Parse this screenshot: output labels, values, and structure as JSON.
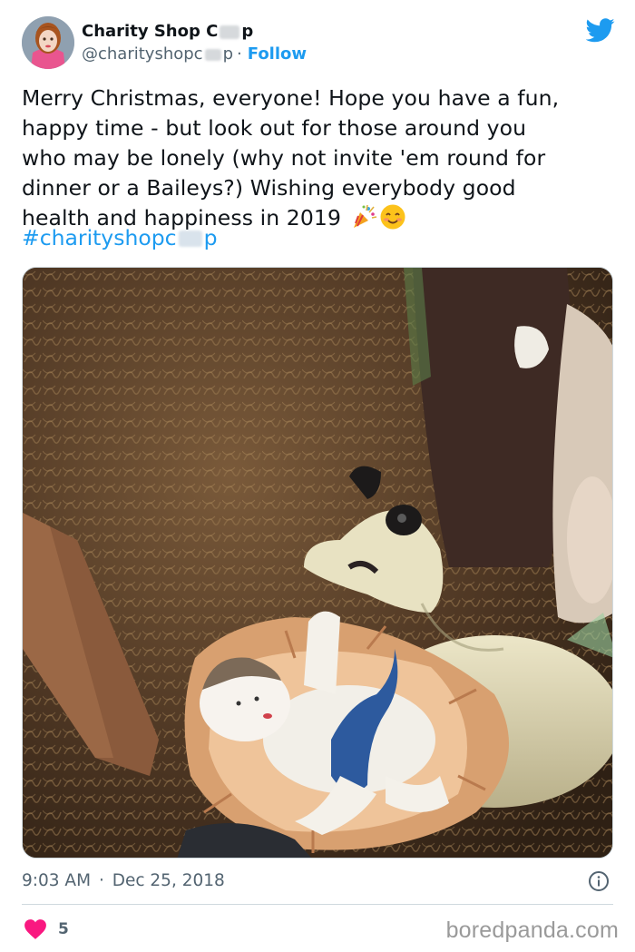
{
  "author": {
    "display_name_start": "Charity Shop C",
    "display_name_end": "p",
    "handle_start": "@charityshopc",
    "handle_end": "p",
    "separator": "·",
    "follow_label": "Follow"
  },
  "tweet": {
    "lines": [
      "Merry Christmas, everyone! Hope you have a fun,",
      "happy time - but look out for those around you",
      "who may be lonely (why not invite 'em round for",
      "dinner or a Baileys?) Wishing everybody good",
      "health and happiness in 2019"
    ],
    "emojis": [
      "party-popper-icon",
      "smiling-face-icon"
    ],
    "hashtag_start": "#charityshopc",
    "hashtag_end": "p"
  },
  "meta": {
    "time": "9:03 AM",
    "separator": "·",
    "date": "Dec 25, 2018"
  },
  "engagement": {
    "like_count": "5"
  },
  "watermark": "boredpanda.com",
  "colors": {
    "accent": "#1d9bf0",
    "heart": "#f91880",
    "text": "#0f1419",
    "muted": "#536471"
  }
}
